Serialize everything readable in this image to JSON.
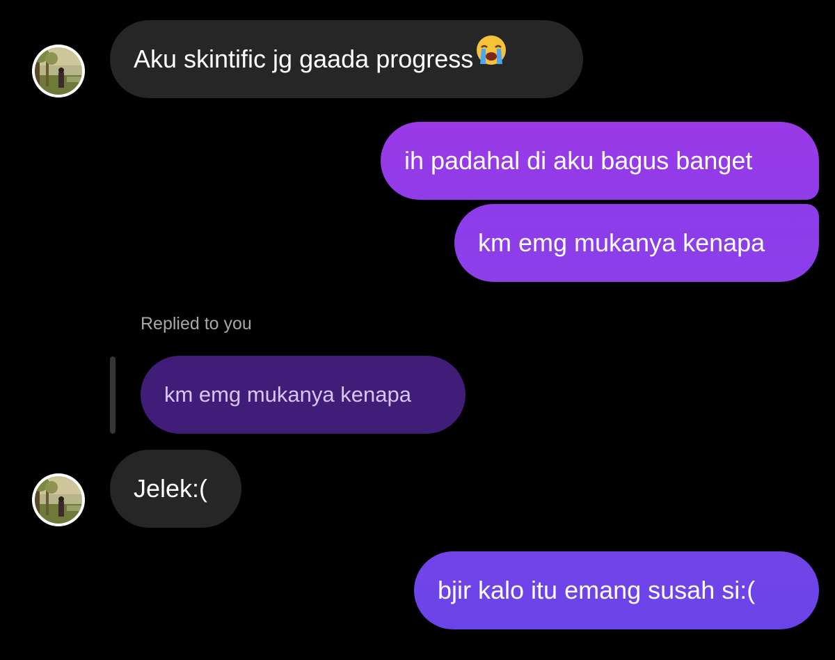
{
  "thread": {
    "msg1": {
      "text": "Aku skintific jg gaada progress",
      "emoji": "loudly-crying-face"
    },
    "msg2": {
      "text": "ih padahal di aku bagus banget"
    },
    "msg3": {
      "text": "km emg mukanya kenapa"
    },
    "reply": {
      "label": "Replied to you",
      "quoted_text": "km emg mukanya kenapa"
    },
    "msg4": {
      "text": "Jelek:("
    },
    "msg5": {
      "text": "bjir kalo itu emang susah si:("
    }
  },
  "colors": {
    "background": "#000000",
    "incoming_bubble": "#262626",
    "outgoing_gradient_top": "#9b3ae6",
    "outgoing_gradient_bottom": "#6a44e8",
    "reply_quote": "#3f1d79",
    "reply_label": "#a8a8a8"
  }
}
